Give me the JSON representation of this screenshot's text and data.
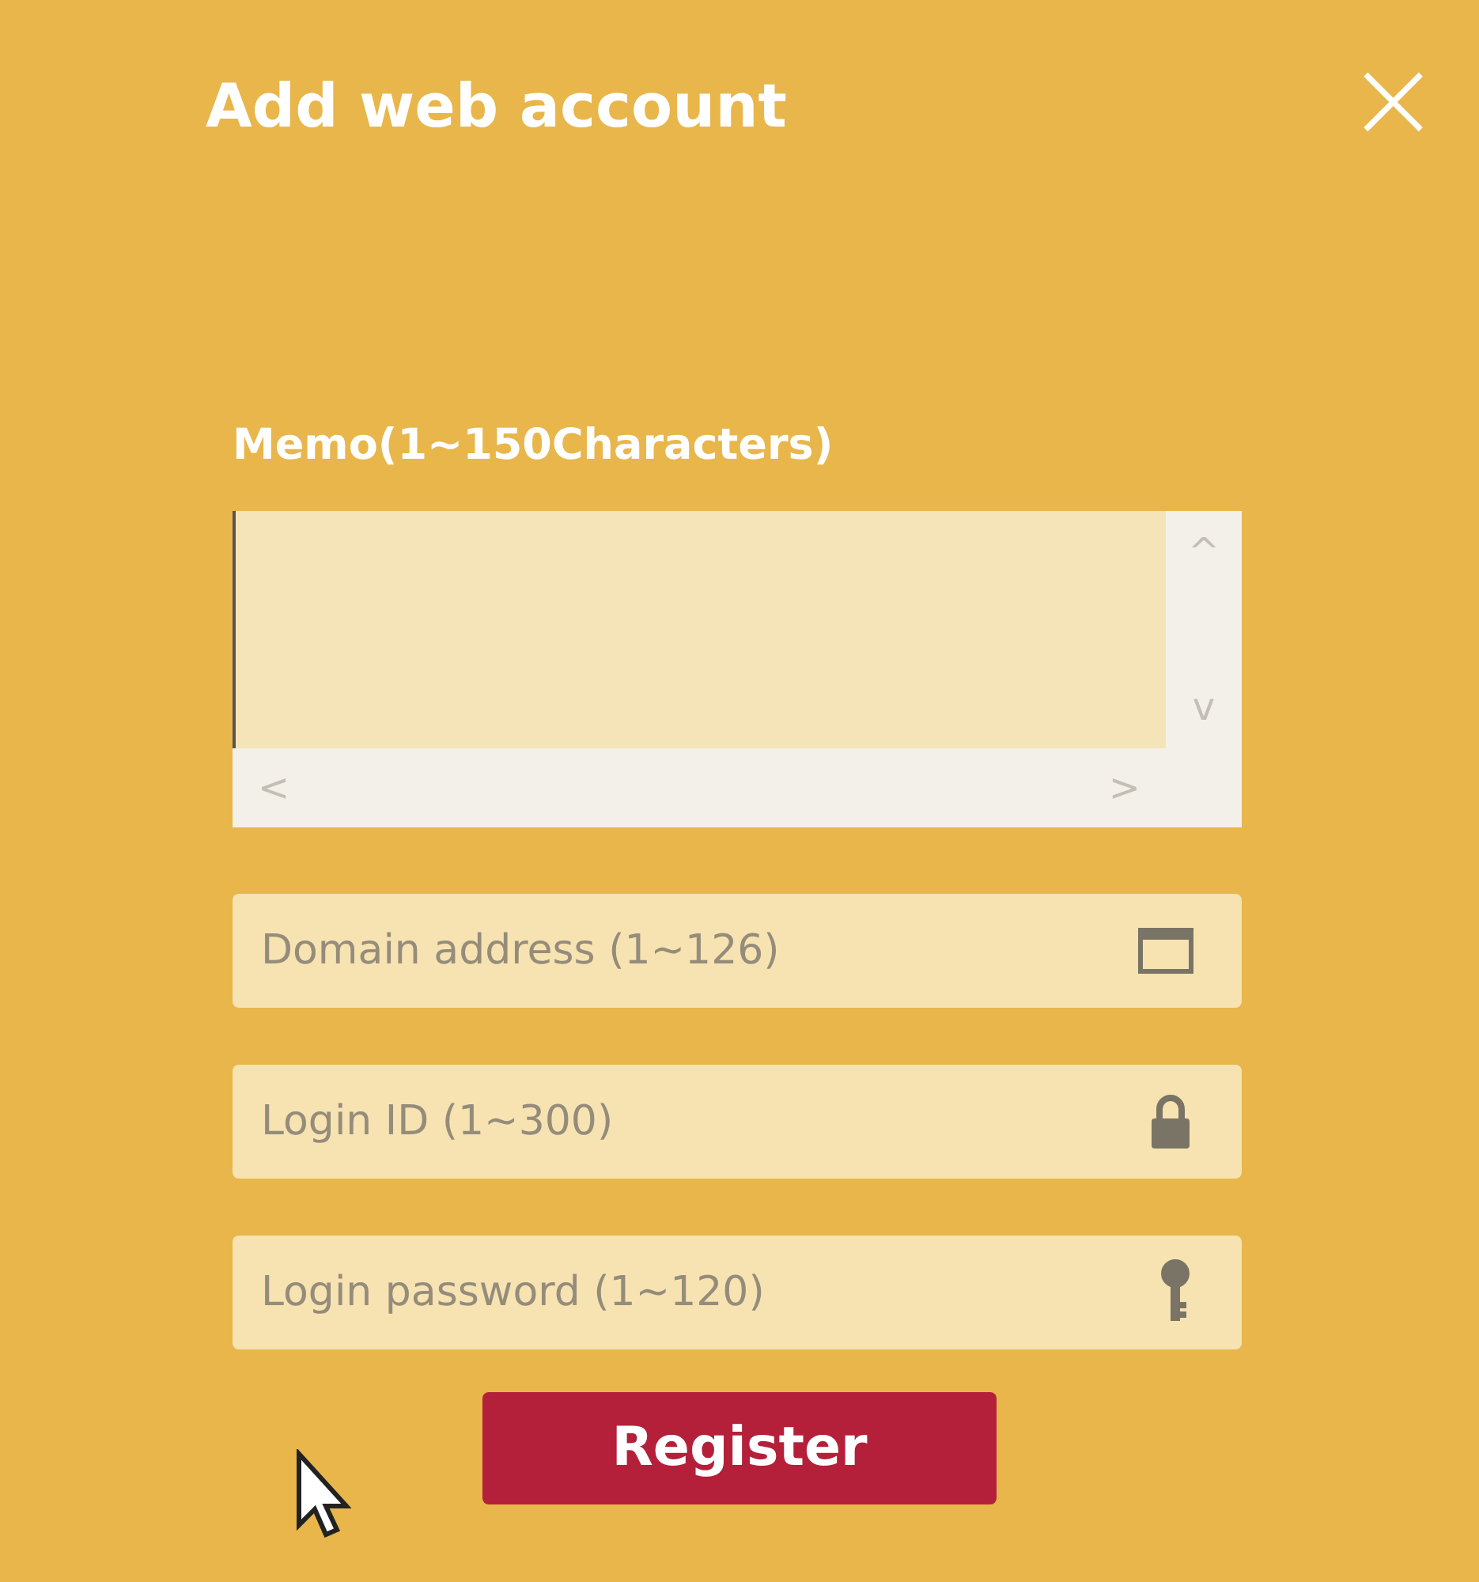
{
  "dialog": {
    "title": "Add web account",
    "close": "×"
  },
  "memo": {
    "label": "Memo(1~150Characters)",
    "up": "^",
    "down": "v",
    "left": "<",
    "right": ">"
  },
  "fields": [
    {
      "placeholder": "Domain address (1~126)",
      "kind": "window"
    },
    {
      "placeholder": "Login ID (1~300)",
      "kind": "lock"
    },
    {
      "placeholder": "Login password (1~120)",
      "kind": "key"
    }
  ],
  "register": "Register"
}
